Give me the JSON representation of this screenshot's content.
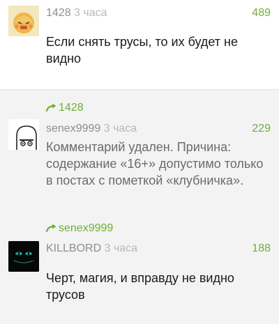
{
  "comments": [
    {
      "author": "1428",
      "time": "3 часа",
      "score": "489",
      "text": "Если снять трусы, то их будет не видно"
    },
    {
      "reply_to": "1428",
      "author": "senex9999",
      "time": "3 часа",
      "score": "229",
      "text": "Комментарий удален. Причина: содержание «16+» допустимо только в постах с пометкой «клубничка»."
    },
    {
      "reply_to": "senex9999",
      "author": "KILLBORD",
      "time": "3 часа",
      "score": "188",
      "text": "Черт, магия, и вправду не видно трусов"
    }
  ],
  "colors": {
    "score": "#6eae3a",
    "reply_link": "#6eae3a",
    "author": "#8e8e8e",
    "time": "#b8b8b8",
    "nested_background": "#f3f3f4"
  },
  "icons": {
    "reply": "reply-arrow-icon"
  }
}
